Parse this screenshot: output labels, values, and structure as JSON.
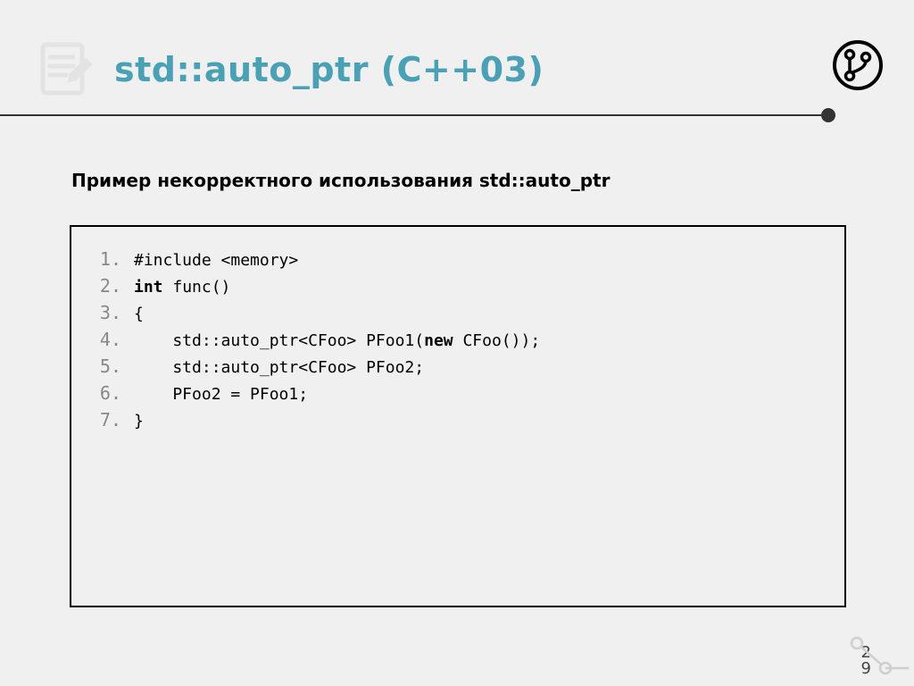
{
  "title": "std::auto_ptr (C++03)",
  "subtitle": "Пример некорректного использования std::auto_ptr",
  "code": {
    "lines": [
      {
        "n": "1.",
        "tokens": [
          {
            "t": "#include <memory>"
          }
        ]
      },
      {
        "n": "2.",
        "tokens": [
          {
            "t": "int",
            "kw": true
          },
          {
            "t": " func()"
          }
        ]
      },
      {
        "n": "3.",
        "tokens": [
          {
            "t": "{"
          }
        ]
      },
      {
        "n": "4.",
        "tokens": [
          {
            "t": "    std::auto_ptr<CFoo> PFoo1("
          },
          {
            "t": "new",
            "kw": true
          },
          {
            "t": " CFoo());"
          }
        ]
      },
      {
        "n": "5.",
        "tokens": [
          {
            "t": "    std::auto_ptr<CFoo> PFoo2;"
          }
        ]
      },
      {
        "n": "6.",
        "tokens": [
          {
            "t": "    PFoo2 = PFoo1;"
          }
        ]
      },
      {
        "n": "7.",
        "tokens": [
          {
            "t": "}"
          }
        ]
      }
    ]
  },
  "page": {
    "a": "2",
    "b": "9"
  },
  "icons": {
    "header": "notepad-icon",
    "corner": "git-branch-icon"
  },
  "colors": {
    "accent": "#4aa0b5",
    "muted": "#cfcfcf"
  }
}
